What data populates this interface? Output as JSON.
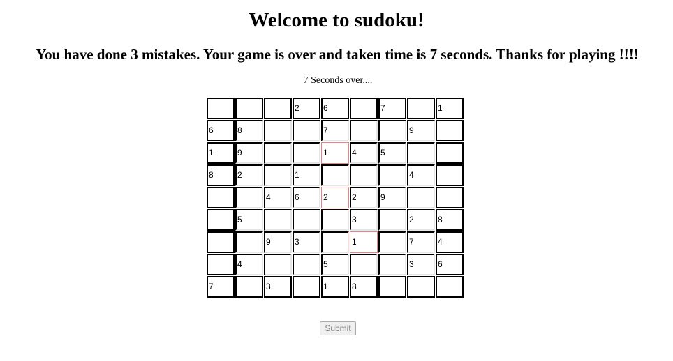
{
  "page": {
    "title": "Welcome to sudoku!",
    "status_message": "You have done 3 mistakes. Your game is over and taken time is 7 seconds. Thanks for playing !!!!",
    "timer_text": "7 Seconds over...."
  },
  "board": {
    "rows": [
      [
        "",
        "",
        "",
        "2",
        "6",
        "",
        "7",
        "",
        "1"
      ],
      [
        "6",
        "8",
        "",
        "",
        "7",
        "",
        "",
        "9",
        ""
      ],
      [
        "1",
        "9",
        "",
        "",
        "1",
        "4",
        "5",
        "",
        ""
      ],
      [
        "8",
        "2",
        "",
        "1",
        "",
        "",
        "",
        "4",
        ""
      ],
      [
        "",
        "",
        "4",
        "6",
        "2",
        "2",
        "9",
        "",
        ""
      ],
      [
        "",
        "5",
        "",
        "",
        "",
        "3",
        "",
        "2",
        "8"
      ],
      [
        "",
        "",
        "9",
        "3",
        "",
        "1",
        "",
        "7",
        "4"
      ],
      [
        "",
        "4",
        "",
        "",
        "5",
        "",
        "",
        "3",
        "6"
      ],
      [
        "7",
        "",
        "3",
        "",
        "1",
        "8",
        "",
        "",
        ""
      ]
    ],
    "mistake_cells": [
      [
        2,
        4
      ],
      [
        4,
        4
      ],
      [
        6,
        5
      ]
    ],
    "mistake_color": "#f08080"
  },
  "actions": {
    "submit_label": "Submit"
  }
}
